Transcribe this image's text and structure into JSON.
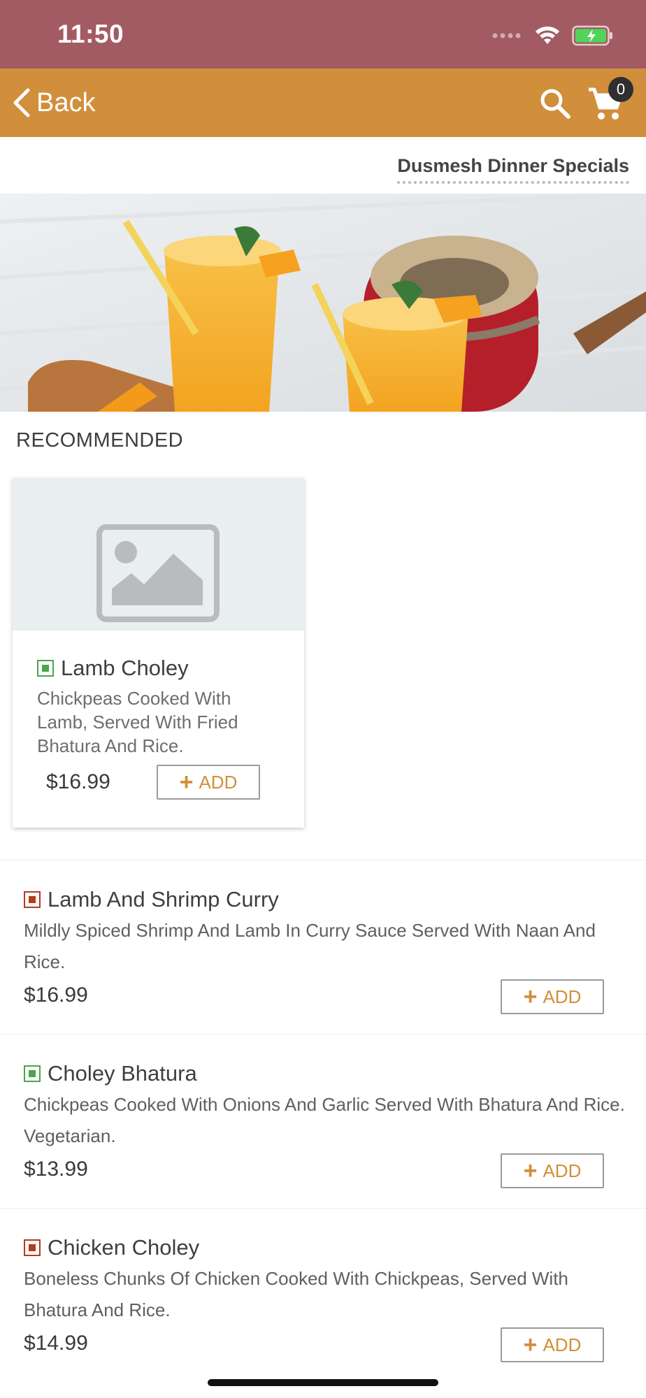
{
  "status_bar": {
    "time": "11:50"
  },
  "nav": {
    "back_label": "Back",
    "cart_count": "0"
  },
  "menu": {
    "title": "Dusmesh Dinner Specials"
  },
  "recommended": {
    "heading": "RECOMMENDED",
    "card": {
      "name": "Lamb Choley",
      "diet": "veg",
      "description": "Chickpeas Cooked With Lamb, Served With Fried Bhatura And Rice.",
      "price": "$16.99",
      "add_label": "ADD"
    }
  },
  "items": [
    {
      "name": "Lamb And Shrimp Curry",
      "diet": "non-veg",
      "description": "Mildly Spiced Shrimp And Lamb In Curry Sauce Served With Naan And Rice.",
      "price": "$16.99",
      "add_label": "ADD"
    },
    {
      "name": "Choley Bhatura",
      "diet": "veg",
      "description": "Chickpeas Cooked With Onions And Garlic Served With Bhatura And Rice. Vegetarian.",
      "price": "$13.99",
      "add_label": "ADD"
    },
    {
      "name": "Chicken Choley",
      "diet": "non-veg",
      "description": "Boneless Chunks Of Chicken Cooked With Chickpeas, Served With Bhatura And Rice.",
      "price": "$14.99",
      "add_label": "ADD"
    }
  ],
  "colors": {
    "status_bar": "#a35b63",
    "nav_bar": "#d18e3b",
    "accent": "#d28f3a",
    "veg": "#4aa64a",
    "non_veg": "#b63a1c"
  },
  "icons": [
    "back-chevron-icon",
    "search-icon",
    "cart-icon",
    "wifi-icon",
    "battery-icon",
    "image-placeholder-icon",
    "veg-icon",
    "non-veg-icon",
    "plus-icon"
  ]
}
